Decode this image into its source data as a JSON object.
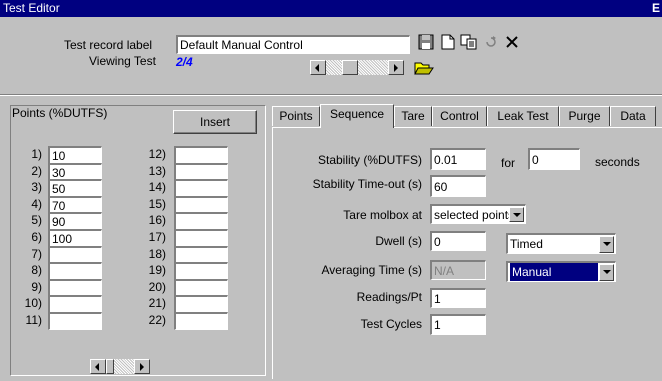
{
  "window": {
    "title": "Test Editor",
    "close_label": "E"
  },
  "header": {
    "record_label_text": "Test record label",
    "record_label_value": "Default Manual Control",
    "viewing_text": "Viewing Test",
    "viewing_value": "2/4"
  },
  "points_panel": {
    "title": "Points (%DUTFS)",
    "insert_label": "Insert",
    "points": [
      {
        "label": "1)",
        "value": "10"
      },
      {
        "label": "2)",
        "value": "30"
      },
      {
        "label": "3)",
        "value": "50"
      },
      {
        "label": "4)",
        "value": "70"
      },
      {
        "label": "5)",
        "value": "90"
      },
      {
        "label": "6)",
        "value": "100"
      },
      {
        "label": "7)",
        "value": ""
      },
      {
        "label": "8)",
        "value": ""
      },
      {
        "label": "9)",
        "value": ""
      },
      {
        "label": "10)",
        "value": ""
      },
      {
        "label": "11)",
        "value": ""
      },
      {
        "label": "12)",
        "value": ""
      },
      {
        "label": "13)",
        "value": ""
      },
      {
        "label": "14)",
        "value": ""
      },
      {
        "label": "15)",
        "value": ""
      },
      {
        "label": "16)",
        "value": ""
      },
      {
        "label": "17)",
        "value": ""
      },
      {
        "label": "18)",
        "value": ""
      },
      {
        "label": "19)",
        "value": ""
      },
      {
        "label": "20)",
        "value": ""
      },
      {
        "label": "21)",
        "value": ""
      },
      {
        "label": "22)",
        "value": ""
      }
    ]
  },
  "tabs": [
    {
      "label": "Points"
    },
    {
      "label": "Sequence",
      "active": true
    },
    {
      "label": "Tare"
    },
    {
      "label": "Control"
    },
    {
      "label": "Leak Test"
    },
    {
      "label": "Purge"
    },
    {
      "label": "Data"
    }
  ],
  "sequence": {
    "stability_label": "Stability (%DUTFS)",
    "stability_value": "0.01",
    "for_label": "for",
    "for_value": "0",
    "seconds_label": "seconds",
    "timeout_label": "Stability Time-out (s)",
    "timeout_value": "60",
    "tare_label": "Tare molbox at",
    "tare_value": "selected points",
    "dwell_label": "Dwell (s)",
    "dwell_value": "0",
    "dwell_mode": "Timed",
    "averaging_label": "Averaging Time (s)",
    "averaging_value": "N/A",
    "averaging_mode": "Manual",
    "readings_label": "Readings/Pt",
    "readings_value": "1",
    "cycles_label": "Test Cycles",
    "cycles_value": "1"
  }
}
